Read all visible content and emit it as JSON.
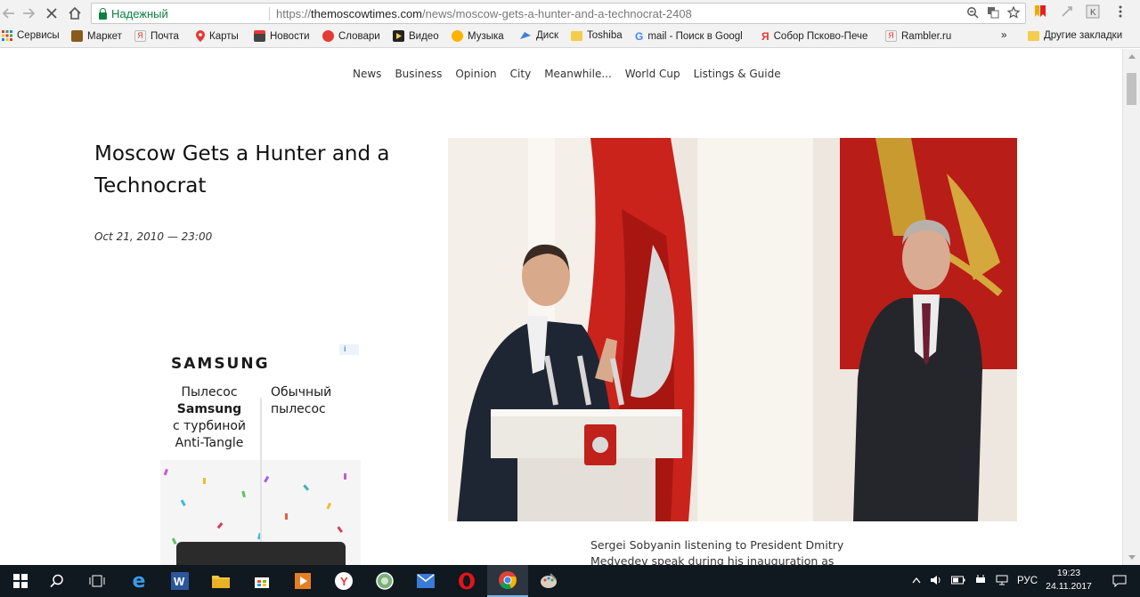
{
  "browser": {
    "secure_label": "Надежный",
    "url_scheme": "https://",
    "url_host": "themoscowtimes.com",
    "url_path": "/news/moscow-gets-a-hunter-and-a-technocrat-2408"
  },
  "bookmarks": {
    "items": [
      {
        "label": "Сервисы",
        "icon": "apps-grid-icon"
      },
      {
        "label": "Маркет",
        "icon": "market-icon"
      },
      {
        "label": "Почта",
        "icon": "yandex-icon"
      },
      {
        "label": "Карты",
        "icon": "map-pin-icon"
      },
      {
        "label": "Новости",
        "icon": "news-icon"
      },
      {
        "label": "Словари",
        "icon": "dictionary-icon"
      },
      {
        "label": "Видео",
        "icon": "video-icon"
      },
      {
        "label": "Музыка",
        "icon": "music-icon"
      },
      {
        "label": "Диск",
        "icon": "disk-icon"
      },
      {
        "label": "Toshiba",
        "icon": "folder-icon"
      },
      {
        "label": "mail - Поиск в Googl",
        "icon": "google-icon"
      },
      {
        "label": "Собор Псково-Пече",
        "icon": "yandex-icon"
      },
      {
        "label": "Rambler.ru",
        "icon": "yandex-icon"
      }
    ],
    "overflow": "»",
    "other_folder": "Другие закладки"
  },
  "sitenav": [
    "News",
    "Business",
    "Opinion",
    "City",
    "Meanwhile...",
    "World Cup",
    "Listings & Guide"
  ],
  "article": {
    "title": "Moscow Gets a Hunter and a Technocrat",
    "date": "Oct 21, 2010 — 23:00",
    "caption": "Sergei Sobyanin listening to President Dmitry Medvedev speak during his inauguration as"
  },
  "ad": {
    "brand": "SAMSUNG",
    "left_line1": "Пылесос",
    "left_line2": "Samsung",
    "left_line3": "с турбиной",
    "left_line4": "Anti-Tangle",
    "right_line1": "Обычный",
    "right_line2": "пылесос"
  },
  "tray": {
    "lang": "РУС",
    "time": "19:23",
    "date": "24.11.2017"
  },
  "colors": {
    "secure_green": "#0b8043",
    "taskbar_bg": "#101820"
  }
}
